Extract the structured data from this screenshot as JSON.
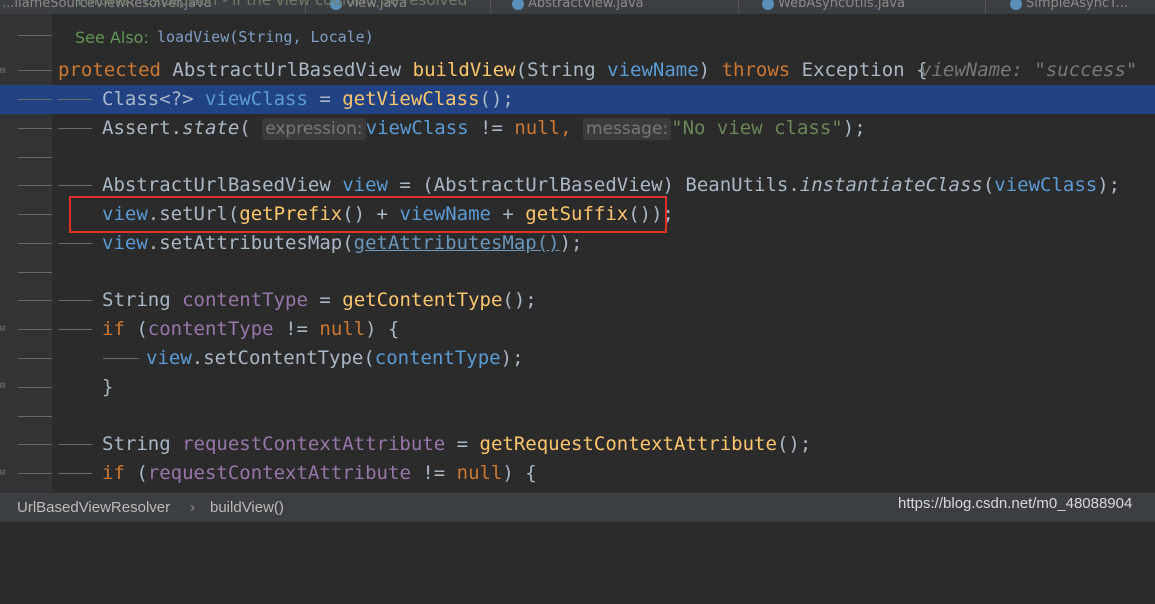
{
  "tabs": [
    {
      "label": "...liameSourceViewResolver.java"
    },
    {
      "label": "View.java"
    },
    {
      "label": "AbstractView.java"
    },
    {
      "label": "WebAsyncUtils.java"
    },
    {
      "label": "SimpleAsyncT..."
    }
  ],
  "javadoc": {
    "throws_text": "Throws:  Exception - if the view couldn't be resolved",
    "see_also_label": "See Also:",
    "see_also_ref": "loadView(String, Locale)"
  },
  "code": {
    "l1": {
      "protected": "protected",
      "type": "AbstractUrlBasedView",
      "method": "buildView",
      "paren_open": "(",
      "ptype": "String",
      "pname": "viewName",
      "paren_close": ")",
      "throws": "throws",
      "exc": "Exception",
      "brace": "{",
      "inlay": "viewName: \"success\""
    },
    "l2": {
      "a": "Class<?> ",
      "b": "viewClass",
      "c": " = ",
      "d": "getViewClass",
      "e": "();"
    },
    "l3": {
      "a": "Assert.",
      "b": "state",
      "c": "(",
      "hint1": "expression:",
      "d": "viewClass",
      "e": " != ",
      "f": "null",
      "g": ",",
      "hint2": "message:",
      "h": "\"No view class\"",
      "i": ");"
    },
    "l4": {
      "a": "AbstractUrlBasedView ",
      "b": "view",
      "c": " = (AbstractUrlBasedView) BeanUtils.",
      "d": "instantiateClass",
      "e": "(",
      "f": "viewClass",
      "g": ");"
    },
    "l5": {
      "a": "view",
      "b": ".setUrl(",
      "c": "getPrefix",
      "d": "() + ",
      "e": "viewName",
      "f": " + ",
      "g": "getSuffix",
      "h": "());"
    },
    "l6": {
      "a": "view",
      "b": ".setAttributesMap(",
      "c": "getAttributesMap()",
      "d": ");"
    },
    "l7": {
      "a": "String ",
      "b": "contentType",
      "c": " = ",
      "d": "getContentType",
      "e": "();"
    },
    "l8": {
      "a": "if",
      "b": " (",
      "c": "contentType",
      "d": " != ",
      "e": "null",
      "f": ") {"
    },
    "l9": {
      "a": "view",
      "b": ".setContentType(",
      "c": "contentType",
      "d": ");"
    },
    "l10": {
      "a": "}"
    },
    "l11": {
      "a": "String ",
      "b": "requestContextAttribute",
      "c": " = ",
      "d": "getRequestContextAttribute",
      "e": "();"
    },
    "l12": {
      "a": "if",
      "b": " (",
      "c": "requestContextAttribute",
      "d": " != ",
      "e": "null",
      "f": ") {"
    }
  },
  "breadcrumb": {
    "class": "UrlBasedViewResolver",
    "sep": "›",
    "method": "buildView()"
  },
  "watermark": "https://blog.csdn.net/m0_48088904",
  "colors": {
    "background": "#2b2b2b",
    "selection": "#214283",
    "keyword": "#cc7832",
    "method": "#ffc66d",
    "field": "#9876aa",
    "string": "#6a8759",
    "highlight_box": "#e0302a"
  }
}
